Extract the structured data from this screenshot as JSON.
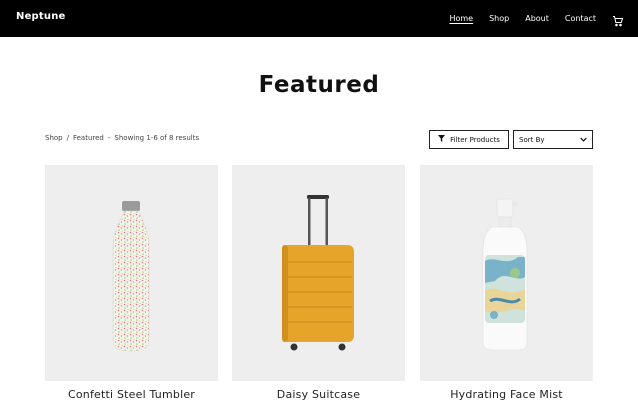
{
  "header": {
    "brand": "Neptune",
    "nav": [
      {
        "label": "Home",
        "active": true
      },
      {
        "label": "Shop",
        "active": false
      },
      {
        "label": "About",
        "active": false
      },
      {
        "label": "Contact",
        "active": false
      }
    ],
    "cart_icon": "cart-icon"
  },
  "page": {
    "title": "Featured"
  },
  "breadcrumb": {
    "items": [
      "Shop",
      "/",
      "Featured",
      "-",
      "Showing 1-6 of 8 results"
    ]
  },
  "toolbar": {
    "filter_label": "Filter Products",
    "filter_icon": "funnel-icon",
    "sort_label": "Sort By",
    "sort_icon": "chevron-down-icon"
  },
  "products": [
    {
      "name": "Confetti Steel Tumbler"
    },
    {
      "name": "Daisy Suitcase"
    },
    {
      "name": "Hydrating Face Mist"
    }
  ],
  "colors": {
    "header_bg": "#000000",
    "card_bg": "#eeeeee",
    "suitcase": "#e6a42a"
  }
}
